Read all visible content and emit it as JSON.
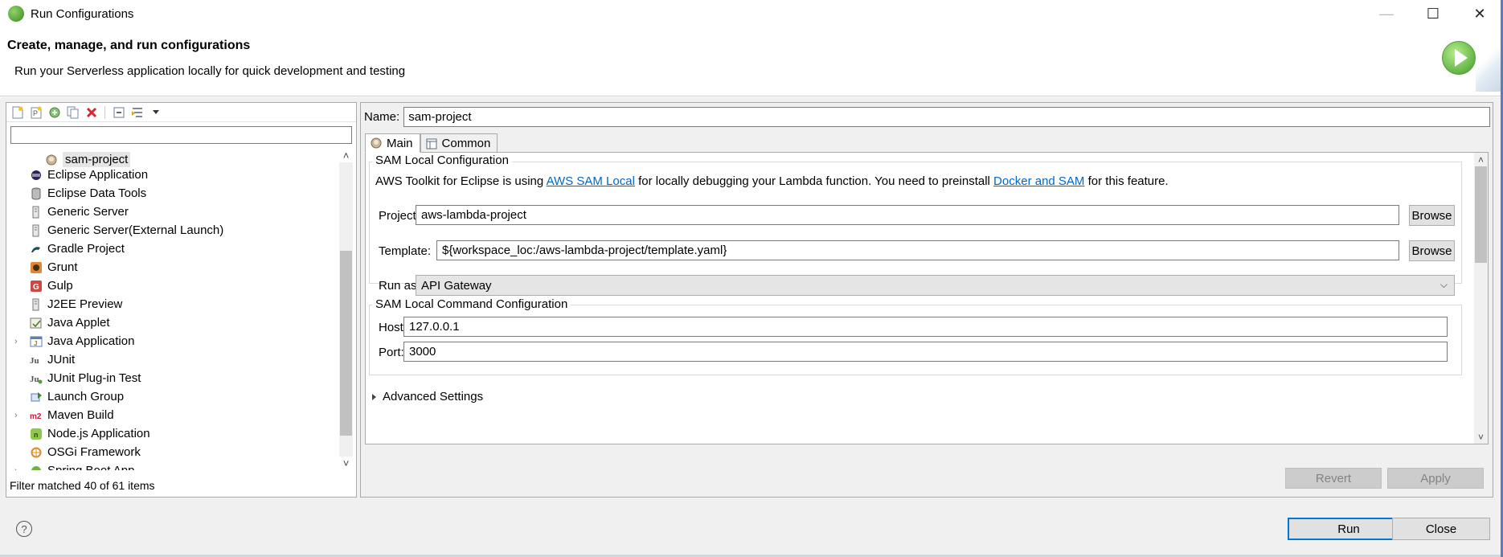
{
  "window": {
    "title": "Run Configurations",
    "controls": {
      "minimize": "—",
      "maximize": "☐",
      "close": "✕"
    }
  },
  "header": {
    "title": "Create, manage, and run configurations",
    "description": "Run your Serverless application locally for quick development and testing"
  },
  "left": {
    "toolbar_icons": [
      "new-config-icon",
      "new-prototype-icon",
      "export-icon",
      "duplicate-icon",
      "delete-icon",
      "collapse-all-icon",
      "filter-icon",
      "dropdown-icon"
    ],
    "filter_value": "",
    "tree": [
      {
        "label": "sam-project",
        "icon": "sam-icon",
        "level": 1,
        "selected": true
      },
      {
        "label": "Eclipse Application",
        "icon": "eclipse-icon",
        "level": 0
      },
      {
        "label": "Eclipse Data Tools",
        "icon": "database-icon",
        "level": 0
      },
      {
        "label": "Generic Server",
        "icon": "server-icon",
        "level": 0
      },
      {
        "label": "Generic Server(External Launch)",
        "icon": "server-icon",
        "level": 0
      },
      {
        "label": "Gradle Project",
        "icon": "gradle-icon",
        "level": 0
      },
      {
        "label": "Grunt",
        "icon": "grunt-icon",
        "level": 0
      },
      {
        "label": "Gulp",
        "icon": "gulp-icon",
        "level": 0
      },
      {
        "label": "J2EE Preview",
        "icon": "server-icon",
        "level": 0
      },
      {
        "label": "Java Applet",
        "icon": "applet-icon",
        "level": 0
      },
      {
        "label": "Java Application",
        "icon": "java-app-icon",
        "level": 0,
        "expandable": true
      },
      {
        "label": "JUnit",
        "icon": "junit-icon",
        "level": 0
      },
      {
        "label": "JUnit Plug-in Test",
        "icon": "junit-plugin-icon",
        "level": 0
      },
      {
        "label": "Launch Group",
        "icon": "launch-group-icon",
        "level": 0
      },
      {
        "label": "Maven Build",
        "icon": "maven-icon",
        "level": 0,
        "expandable": true
      },
      {
        "label": "Node.js Application",
        "icon": "nodejs-icon",
        "level": 0
      },
      {
        "label": "OSGi Framework",
        "icon": "osgi-icon",
        "level": 0
      },
      {
        "label": "Spring Boot App",
        "icon": "spring-icon",
        "level": 0,
        "expandable": true
      }
    ],
    "status": "Filter matched 40 of 61 items"
  },
  "right": {
    "name_label": "Name:",
    "name_value": "sam-project",
    "tabs": [
      {
        "label": "Main",
        "icon": "sam-icon",
        "active": true
      },
      {
        "label": "Common",
        "icon": "common-tab-icon",
        "active": false
      }
    ],
    "sam_config": {
      "title": "SAM Local Configuration",
      "info_prefix": "AWS Toolkit for Eclipse is using ",
      "info_link1": "AWS SAM Local",
      "info_middle": " for locally debugging your Lambda function. You need to preinstall ",
      "info_link2": "Docker and SAM",
      "info_suffix": " for this feature.",
      "project_label": "Project:",
      "project_value": "aws-lambda-project",
      "template_label": "Template:",
      "template_value": "${workspace_loc:/aws-lambda-project/template.yaml}",
      "browse_label": "Browse",
      "runas_label": "Run as:",
      "runas_value": "API Gateway"
    },
    "command_config": {
      "title": "SAM Local Command Configuration",
      "host_label": "Host:",
      "host_value": "127.0.0.1",
      "port_label": "Port:",
      "port_value": "3000"
    },
    "advanced_label": "Advanced Settings",
    "revert_label": "Revert",
    "apply_label": "Apply"
  },
  "footer": {
    "help": "?",
    "run_label": "Run",
    "close_label": "Close"
  }
}
